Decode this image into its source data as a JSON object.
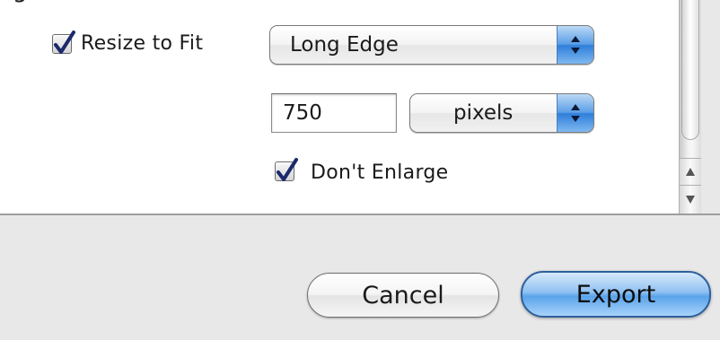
{
  "resize": {
    "checkbox_label": "Resize to Fit",
    "checked": true,
    "mode_value": "Long Edge",
    "size_value": "750",
    "unit_value": "pixels",
    "dont_enlarge_label": "Don't Enlarge",
    "dont_enlarge_checked": true
  },
  "scrollbar": {
    "up_icon": "arrow-up-icon",
    "down_icon": "arrow-down-icon"
  },
  "actions": {
    "cancel_label": "Cancel",
    "export_label": "Export"
  },
  "colors": {
    "accent": "#5aa3ea",
    "panel_bg": "#ffffff",
    "footer_bg": "#e8e8e8"
  }
}
